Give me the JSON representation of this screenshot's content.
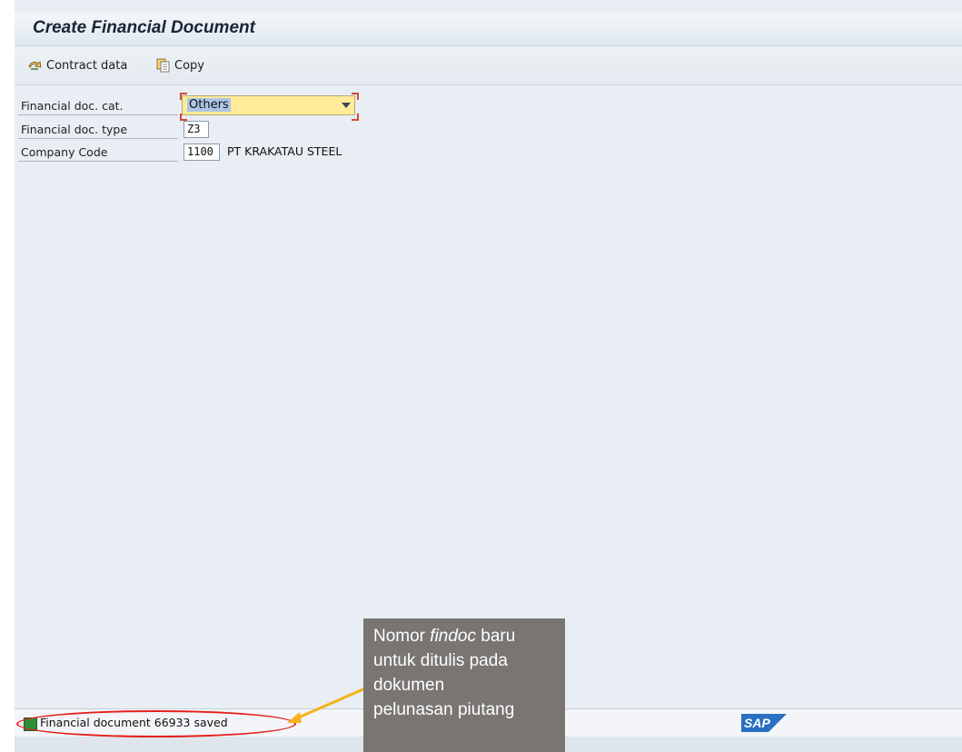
{
  "window": {
    "title": "Create Financial Document"
  },
  "toolbar": {
    "contract_data_label": "Contract data",
    "copy_label": "Copy"
  },
  "form": {
    "fin_doc_cat": {
      "label": "Financial doc. cat.",
      "value": "Others"
    },
    "fin_doc_type": {
      "label": "Financial doc. type",
      "value": "Z3"
    },
    "company_code": {
      "label": "Company Code",
      "value": "1100",
      "name": "PT KRAKATAU STEEL"
    }
  },
  "status_bar": {
    "message": "Financial document 66933 saved",
    "logo": "SAP"
  },
  "annotation": {
    "line1_pre": "Nomor ",
    "line1_em": "findoc",
    "line1_post": " baru",
    "line2": "untuk ditulis pada",
    "line3": "dokumen",
    "line4": "pelunasan piutang"
  },
  "colors": {
    "highlight": "#e3211c",
    "arrow": "#f5b21b",
    "callout_bg": "#787573",
    "dropdown_bg": "#ffeb9a"
  },
  "icons": {
    "contract_data": "contract-data-icon",
    "copy": "copy-icon",
    "status": "success-icon"
  }
}
